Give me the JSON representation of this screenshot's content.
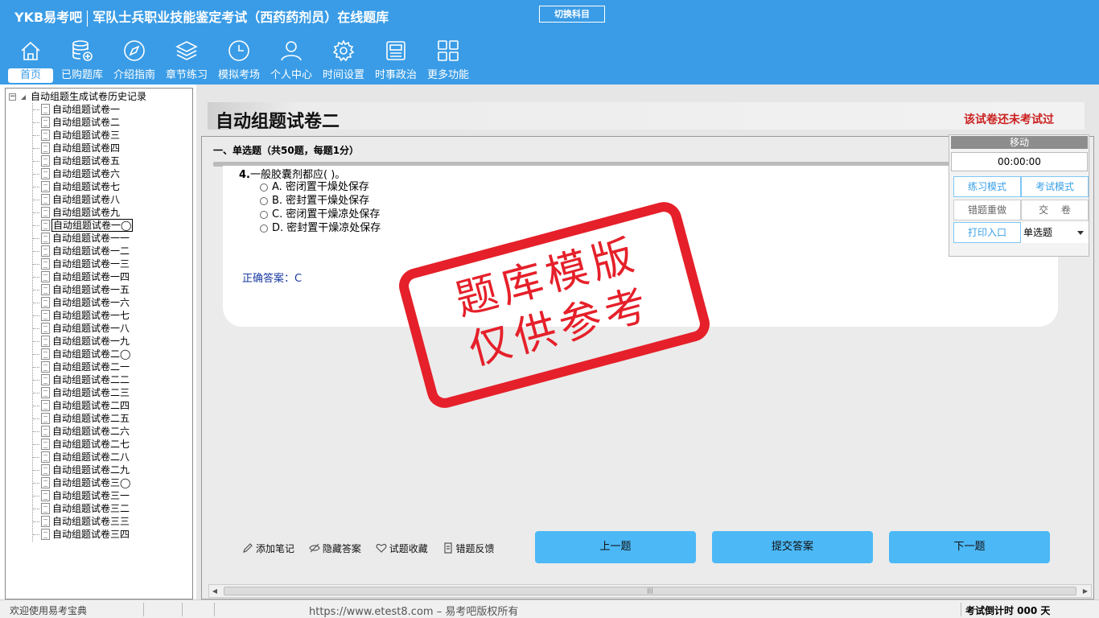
{
  "header": {
    "brand": "YKB易考吧",
    "subtitle": "军队士兵职业技能鉴定考试（西药药剂员）在线题库",
    "switch_subject": "切换科目",
    "nav": [
      {
        "label": "首页",
        "icon": "home-icon"
      },
      {
        "label": "已购题库",
        "icon": "database-icon"
      },
      {
        "label": "介绍指南",
        "icon": "compass-icon"
      },
      {
        "label": "章节练习",
        "icon": "layers-icon"
      },
      {
        "label": "模拟考场",
        "icon": "clock-icon"
      },
      {
        "label": "个人中心",
        "icon": "user-icon"
      },
      {
        "label": "时间设置",
        "icon": "gear-icon"
      },
      {
        "label": "时事政治",
        "icon": "newspaper-icon"
      },
      {
        "label": "更多功能",
        "icon": "grid-icon"
      }
    ]
  },
  "tree": {
    "root": "自动组题生成试卷历史记录",
    "items": [
      "自动组题试卷一",
      "自动组题试卷二",
      "自动组题试卷三",
      "自动组题试卷四",
      "自动组题试卷五",
      "自动组题试卷六",
      "自动组题试卷七",
      "自动组题试卷八",
      "自动组题试卷九",
      "自动组题试卷一◯",
      "自动组题试卷一一",
      "自动组题试卷一二",
      "自动组题试卷一三",
      "自动组题试卷一四",
      "自动组题试卷一五",
      "自动组题试卷一六",
      "自动组题试卷一七",
      "自动组题试卷一八",
      "自动组题试卷一九",
      "自动组题试卷二◯",
      "自动组题试卷二一",
      "自动组题试卷二二",
      "自动组题试卷二三",
      "自动组题试卷二四",
      "自动组题试卷二五",
      "自动组题试卷二六",
      "自动组题试卷二七",
      "自动组题试卷二八",
      "自动组题试卷二九",
      "自动组题试卷三◯",
      "自动组题试卷三一",
      "自动组题试卷三二",
      "自动组题试卷三三",
      "自动组题试卷三四"
    ],
    "selected_index": 9
  },
  "main": {
    "paper_title": "自动组题试卷二",
    "status_note": "该试卷还未考试过",
    "section_heading": "一、单选题（共50题，每题1分）",
    "question": {
      "number": "4.",
      "text": "一般胶囊剂都应( )。",
      "options": [
        "A. 密闭置干燥处保存",
        "B. 密封置干燥处保存",
        "C. 密闭置干燥凉处保存",
        "D. 密封置干燥凉处保存"
      ],
      "answer_label": "正确答案：",
      "answer_value": "C"
    },
    "actions": [
      {
        "label": "添加笔记",
        "icon": "pencil-icon"
      },
      {
        "label": "隐藏答案",
        "icon": "eye-off-icon"
      },
      {
        "label": "试题收藏",
        "icon": "heart-icon"
      },
      {
        "label": "错题反馈",
        "icon": "feedback-icon"
      }
    ],
    "buttons": {
      "prev": "上一题",
      "submit": "提交答案",
      "next": "下一题"
    }
  },
  "panel": {
    "move": "移动",
    "timer": "00:00:00",
    "practice_mode": "练习模式",
    "exam_mode": "考试模式",
    "redo_wrong": "错题重做",
    "hand_in": "交　 卷",
    "print_entry": "打印入口",
    "question_type": "单选题"
  },
  "stamp": {
    "line1": "题库模版",
    "line2": "仅供参考"
  },
  "status": {
    "welcome": "欢迎使用易考宝典",
    "copyright": "https://www.etest8.com – 易考吧版权所有",
    "countdown": "考试倒计时 000 天"
  },
  "colors": {
    "header_bg": "#3a9ce6",
    "button_blue": "#4cb8f6",
    "stamp_red": "#e5202a",
    "status_red": "#cc2020"
  }
}
